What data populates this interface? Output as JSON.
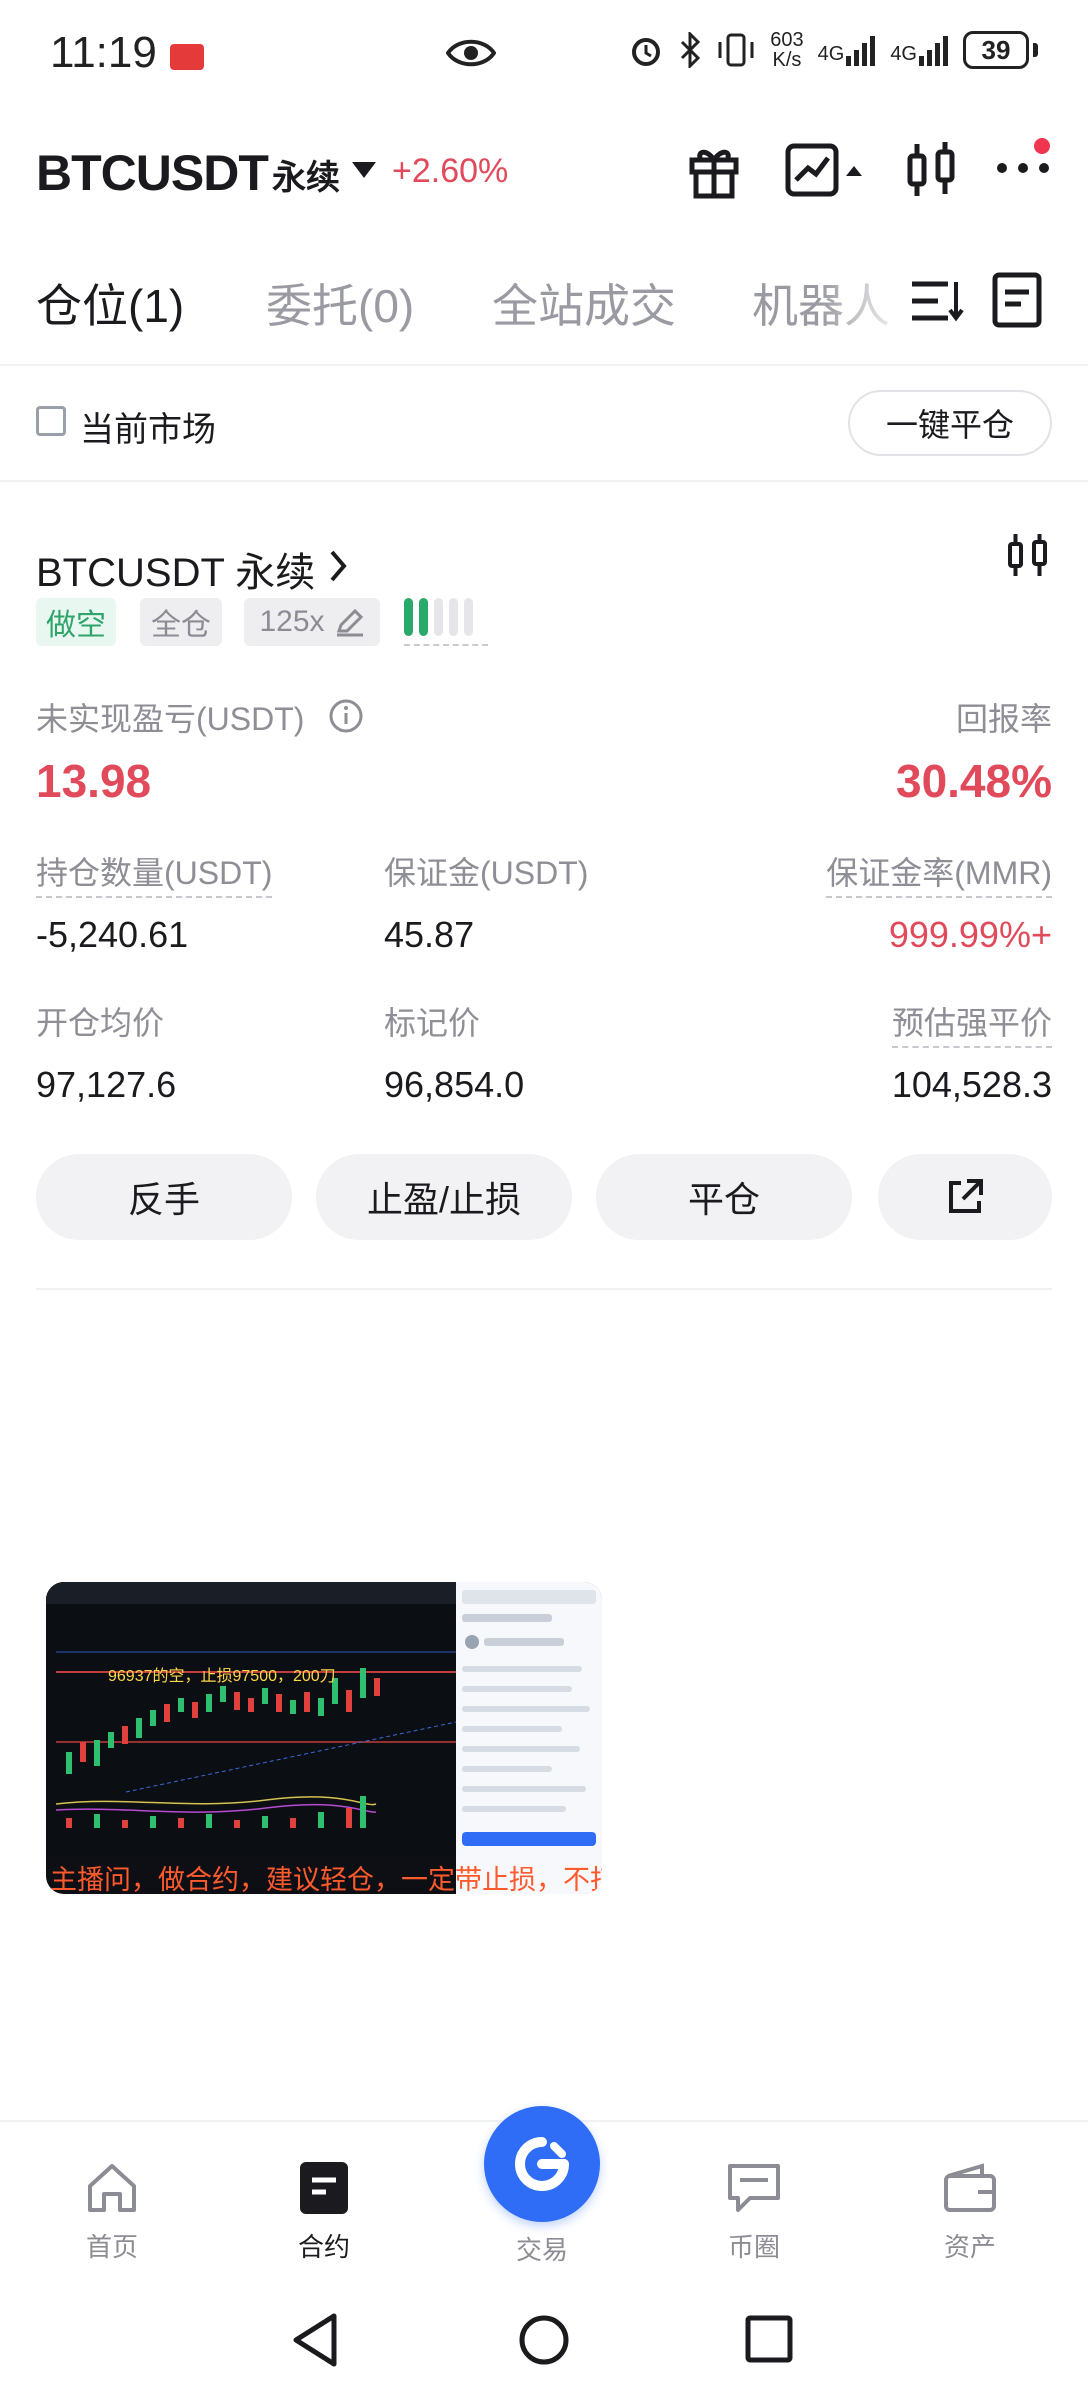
{
  "status_bar": {
    "time": "11:19",
    "net_speed_top": "603",
    "net_speed_bottom": "K/s",
    "signal_1": "4G",
    "signal_2": "4G",
    "battery": "39"
  },
  "header": {
    "symbol": "BTCUSDT",
    "contract_type": "永续",
    "change": "+2.60%",
    "icons": [
      "gift-icon",
      "chart-trend-icon",
      "candlestick-icon",
      "more-icon"
    ]
  },
  "tabs": [
    {
      "label": "仓位(1)",
      "active": true
    },
    {
      "label": "委托(0)",
      "active": false
    },
    {
      "label": "全站成交",
      "active": false
    },
    {
      "label": "机器人",
      "active": false
    }
  ],
  "filter": {
    "current_market_label": "当前市场",
    "close_all_label": "一键平仓"
  },
  "position": {
    "symbol": "BTCUSDT 永续",
    "side_tag": "做空",
    "margin_mode_tag": "全仓",
    "leverage_tag": "125x",
    "risk_level": 2,
    "risk_total": 5,
    "unrealized_pnl_label": "未实现盈亏(USDT)",
    "unrealized_pnl": "13.98",
    "roe_label": "回报率",
    "roe": "30.48%",
    "size_label": "持仓数量(USDT)",
    "size": "-5,240.61",
    "margin_label": "保证金(USDT)",
    "margin": "45.87",
    "mmr_label": "保证金率(MMR)",
    "mmr": "999.99%+",
    "entry_label": "开仓均价",
    "entry": "97,127.6",
    "mark_label": "标记价",
    "mark": "96,854.0",
    "liq_label": "预估强平价",
    "liq": "104,528.3"
  },
  "actions": {
    "reverse": "反手",
    "tp_sl": "止盈/止损",
    "close": "平仓"
  },
  "video": {
    "caption": "主播问，做合约，建议轻仓，一定带止损，不扛单",
    "note": "96937的空，止损97500，200刀"
  },
  "bottom_nav": [
    {
      "label": "首页",
      "icon": "home-icon",
      "active": false
    },
    {
      "label": "合约",
      "icon": "contract-icon",
      "active": true
    },
    {
      "label": "交易",
      "icon": "trade-icon",
      "active": false
    },
    {
      "label": "币圈",
      "icon": "chat-icon",
      "active": false
    },
    {
      "label": "资产",
      "icon": "wallet-icon",
      "active": false
    }
  ],
  "colors": {
    "red": "#e14a5b",
    "green": "#2fa56c",
    "brand_blue": "#2f6df6"
  }
}
